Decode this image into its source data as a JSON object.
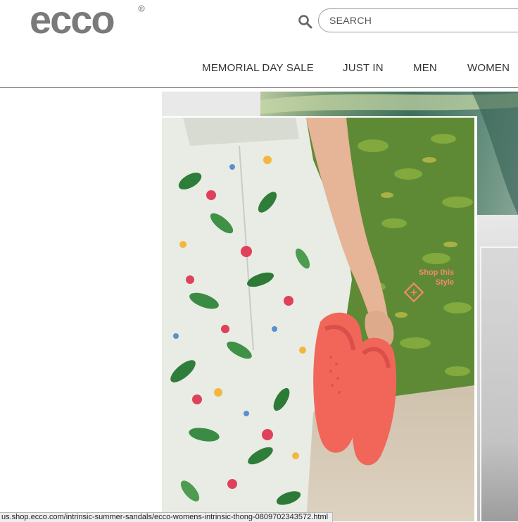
{
  "header": {
    "logo_text": "ecco",
    "search": {
      "placeholder": "SEARCH",
      "value": ""
    },
    "search_icon": "search-icon"
  },
  "nav": {
    "items": [
      {
        "label": "MEMORIAL DAY SALE"
      },
      {
        "label": "JUST IN"
      },
      {
        "label": "MEN"
      },
      {
        "label": "WOMEN"
      }
    ]
  },
  "hero": {
    "shop_label_line1": "Shop this",
    "shop_label_line2": "Style",
    "shop_icon": "plus-diamond-icon",
    "accent_color": "#f08a6c",
    "sandal_color": "#f2665a"
  },
  "status_bar": {
    "url": "us.shop.ecco.com/intrinsic-summer-sandals/ecco-womens-intrinsic-thong-0809702343572.html"
  }
}
